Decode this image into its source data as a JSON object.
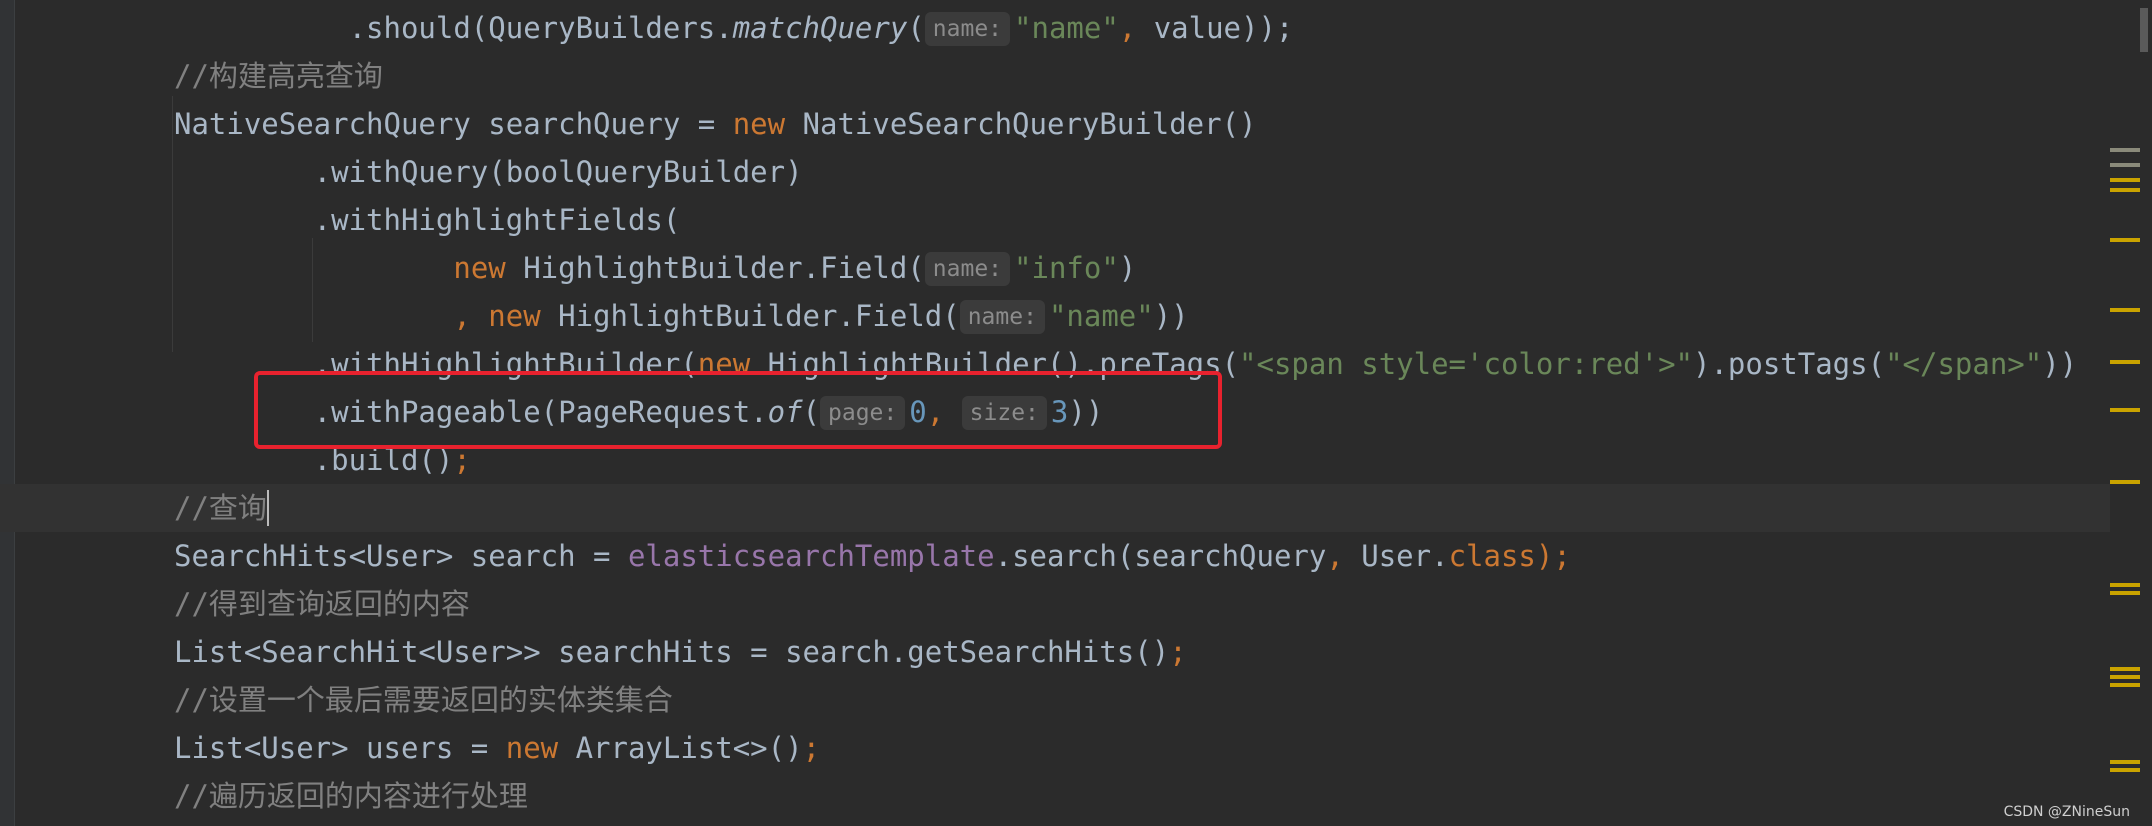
{
  "editor": {
    "lines": [
      [
        {
          "t": "          .should(QueryBuilders.",
          "c": "plain"
        },
        {
          "t": "matchQuery",
          "c": "plain italic"
        },
        {
          "t": "(",
          "c": "plain"
        },
        {
          "h": "name:"
        },
        {
          "t": "\"name\"",
          "c": "str"
        },
        {
          "t": ", ",
          "c": "kw"
        },
        {
          "t": "value));",
          "c": "plain"
        }
      ],
      [
        {
          "t": "//构建高亮查询",
          "c": "comment"
        }
      ],
      [
        {
          "t": "NativeSearchQuery searchQuery = ",
          "c": "plain"
        },
        {
          "t": "new ",
          "c": "kw"
        },
        {
          "t": "NativeSearchQueryBuilder()",
          "c": "plain"
        }
      ],
      [
        {
          "t": "        .withQuery(boolQueryBuilder)",
          "c": "plain"
        }
      ],
      [
        {
          "t": "        .withHighlightFields(",
          "c": "plain"
        }
      ],
      [
        {
          "t": "                ",
          "c": "plain"
        },
        {
          "t": "new ",
          "c": "kw"
        },
        {
          "t": "HighlightBuilder.Field(",
          "c": "plain"
        },
        {
          "h": "name:"
        },
        {
          "t": "\"info\"",
          "c": "str"
        },
        {
          "t": ")",
          "c": "plain"
        }
      ],
      [
        {
          "t": "                ",
          "c": "plain"
        },
        {
          "t": ", new ",
          "c": "kw"
        },
        {
          "t": "HighlightBuilder.Field(",
          "c": "plain"
        },
        {
          "h": "name:"
        },
        {
          "t": "\"name\"",
          "c": "str"
        },
        {
          "t": "))",
          "c": "plain"
        }
      ],
      [
        {
          "t": "        .withHighlightBuilder(",
          "c": "plain"
        },
        {
          "t": "new ",
          "c": "kw"
        },
        {
          "t": "HighlightBuilder().preTags(",
          "c": "plain"
        },
        {
          "t": "\"<span style='color:red'>\"",
          "c": "str"
        },
        {
          "t": ").postTags(",
          "c": "plain"
        },
        {
          "t": "\"</span>\"",
          "c": "str"
        },
        {
          "t": "))",
          "c": "plain"
        }
      ],
      [
        {
          "t": "        .withPageable(PageRequest.",
          "c": "plain"
        },
        {
          "t": "of",
          "c": "plain italic"
        },
        {
          "t": "(",
          "c": "plain"
        },
        {
          "h": "page:"
        },
        {
          "t": "0",
          "c": "num"
        },
        {
          "t": ", ",
          "c": "kw"
        },
        {
          "h": "size:"
        },
        {
          "t": "3",
          "c": "num"
        },
        {
          "t": "))",
          "c": "plain"
        }
      ],
      [
        {
          "t": "        .build()",
          "c": "plain"
        },
        {
          "t": ";",
          "c": "kw"
        }
      ],
      [
        {
          "t": "//查询",
          "c": "comment"
        },
        {
          "caret": true
        }
      ],
      [
        {
          "t": "SearchHits<User> search = ",
          "c": "plain"
        },
        {
          "t": "elasticsearchTemplate",
          "c": "field"
        },
        {
          "t": ".search(searchQuery",
          "c": "plain"
        },
        {
          "t": ", ",
          "c": "kw"
        },
        {
          "t": "User.",
          "c": "plain"
        },
        {
          "t": "class",
          "c": "kw"
        },
        {
          "t": ");",
          "c": "kw"
        }
      ],
      [
        {
          "t": "//得到查询返回的内容",
          "c": "comment"
        }
      ],
      [
        {
          "t": "List<SearchHit<User>> searchHits = search.getSearchHits()",
          "c": "plain"
        },
        {
          "t": ";",
          "c": "kw"
        }
      ],
      [
        {
          "t": "//设置一个最后需要返回的实体类集合",
          "c": "comment"
        }
      ],
      [
        {
          "t": "List<User> users = ",
          "c": "plain"
        },
        {
          "t": "new ",
          "c": "kw"
        },
        {
          "t": "ArrayList<>()",
          "c": "plain"
        },
        {
          "t": ";",
          "c": "kw"
        }
      ],
      [
        {
          "t": "//遍历返回的内容进行处理",
          "c": "comment"
        }
      ]
    ]
  },
  "colors": {
    "background": "#2b2b2b",
    "current_line": "#323232",
    "highlight_box": "#e8222e",
    "marker_warning": "#c9a300",
    "marker_gray": "#8a8a7a"
  },
  "watermark": "CSDN @ZNineSun"
}
